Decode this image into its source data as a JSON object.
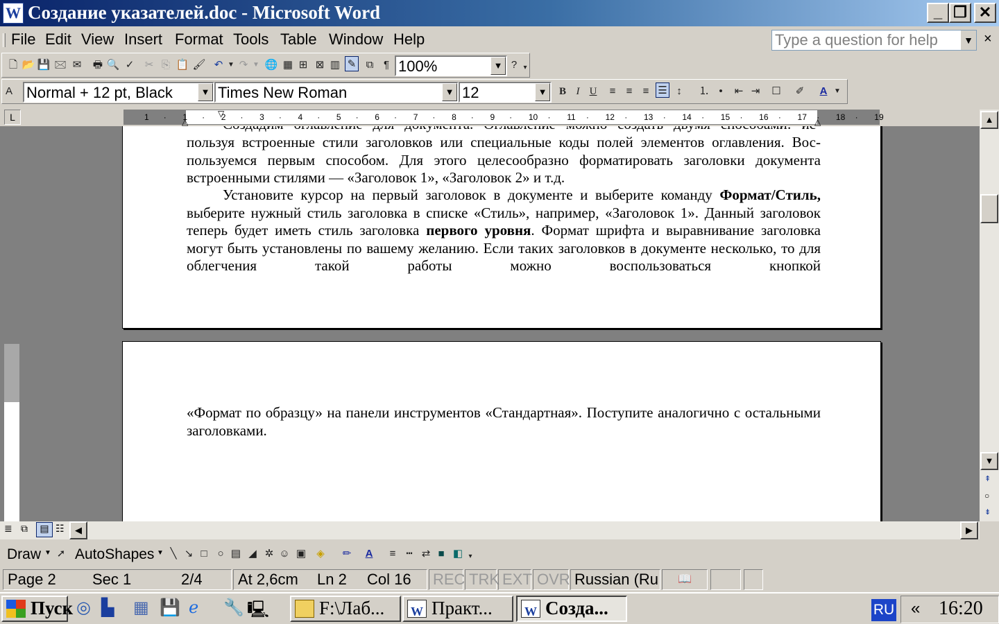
{
  "window": {
    "title": "Создание указателей.doc - Microsoft Word",
    "app_icon": "W",
    "minimize": "_",
    "restore": "❐",
    "close": "✕"
  },
  "menu": {
    "items": [
      "File",
      "Edit",
      "View",
      "Insert",
      "Format",
      "Tools",
      "Table",
      "Window",
      "Help"
    ],
    "help_placeholder": "Type a question for help",
    "help_close": "×"
  },
  "standard_toolbar": {
    "zoom": "100%"
  },
  "formatting_toolbar": {
    "style": "Normal + 12 pt, Black",
    "font": "Times New Roman",
    "size": "12",
    "bold": "B",
    "italic": "I",
    "underline": "U"
  },
  "ruler": {
    "tab_selector": "L",
    "marks": [
      "1",
      "·",
      "1",
      "·",
      "2",
      "·",
      "3",
      "·",
      "4",
      "·",
      "5",
      "·",
      "6",
      "·",
      "7",
      "·",
      "8",
      "·",
      "9",
      "·",
      "10",
      "·",
      "11",
      "·",
      "12",
      "·",
      "13",
      "·",
      "14",
      "·",
      "15",
      "·",
      "16",
      "·",
      "17",
      "·",
      "18",
      "·",
      "19"
    ]
  },
  "document": {
    "page1_line1": "Создадим оглавление для документа. Оглавление можно создать двумя способами: ис-",
    "page1_para1": "пользуя встроенные стили заголовков или специальные коды полей элементов оглавления. Вос-пользуемся первым способом. Для этого целесообразно форматировать заголовки документа встроенными стилями — «Заголовок 1», «Заголовок 2» и т.д.",
    "page1_para2_a": "Установите курсор на первый заголовок в документе и выберите команду ",
    "page1_para2_b": "Формат/Стиль,",
    "page1_para2_c": " выберите нужный стиль заголовка в списке «Стиль», например, «Заголовок 1». Данный заголовок теперь будет иметь стиль заголовка ",
    "page1_para2_d": "первого уровня",
    "page1_para2_e": ". Формат шрифта и выравнивание заголовка могут быть установлены по вашему желанию. Если таких заголовков в документе несколько, то для облегчения такой работы можно воспользоваться кнопкой",
    "page2_para": "«Формат по образцу» на панели инструментов «Стандартная». Поступите аналогично с остальными заголовками."
  },
  "drawing_toolbar": {
    "draw": "Draw",
    "autoshapes": "AutoShapes"
  },
  "status": {
    "page": "Page 2",
    "sec": "Sec 1",
    "pages": "2/4",
    "at": "At 2,6cm",
    "ln": "Ln 2",
    "col": "Col 16",
    "rec": "REC",
    "trk": "TRK",
    "ext": "EXT",
    "ovr": "OVR",
    "lang": "Russian (Ru"
  },
  "taskbar": {
    "start": "Пуск",
    "tasks": [
      "F:\\Лаб...",
      "Практ...",
      "Созда..."
    ],
    "lang": "RU",
    "chevron": "«",
    "clock": "16:20"
  },
  "colors": {
    "title_start": "#0a246a",
    "title_end": "#a6caf0",
    "chrome": "#d4d0c8",
    "doc_bg": "#808080",
    "highlight": "#0a246a",
    "tray_lang": "#1c44c8"
  }
}
